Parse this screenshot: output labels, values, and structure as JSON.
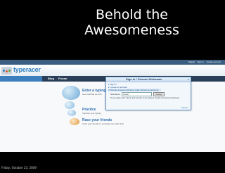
{
  "slide": {
    "title_line1": "Behold the",
    "title_line2": "Awesomeness",
    "date": "Friday, October 23, 2009"
  },
  "site": {
    "logo_text": "typeracer",
    "guest_label": "Guest",
    "guest_links": [
      "Sign in",
      "Create account"
    ],
    "nav": [
      "Blog",
      "Forum"
    ]
  },
  "main": {
    "enter_title": "Enter a typing race",
    "enter_sub": "Get matched up with",
    "practice_title": "Practice",
    "practice_sub": "Improve your typing",
    "race_title": "Race your friends",
    "race_sub": "Invite your friends to a private race with chat"
  },
  "dialog": {
    "title": "Sign In / Choose Nickname",
    "close": "x",
    "options": [
      "Sign in",
      "Create an account",
      "Choose a guest nickname (play without an account)"
    ],
    "nickname_label": "Nickname:",
    "nickname_value": "Guest",
    "accept_label": "Accept",
    "note": "If you want your name and scores to be saved, create an account instead.",
    "cancel_label": "Cancel"
  },
  "colors": {
    "slide_bg": "#000000",
    "title": "#ffffff",
    "brand_blue": "#2f7fbf",
    "nav_bg": "#2a3f57",
    "dialog_border": "#6d9fd0"
  },
  "icons": {
    "logo": "typeracer-logo-icon",
    "arrow": "triangle-right-icon",
    "close": "close-icon"
  }
}
